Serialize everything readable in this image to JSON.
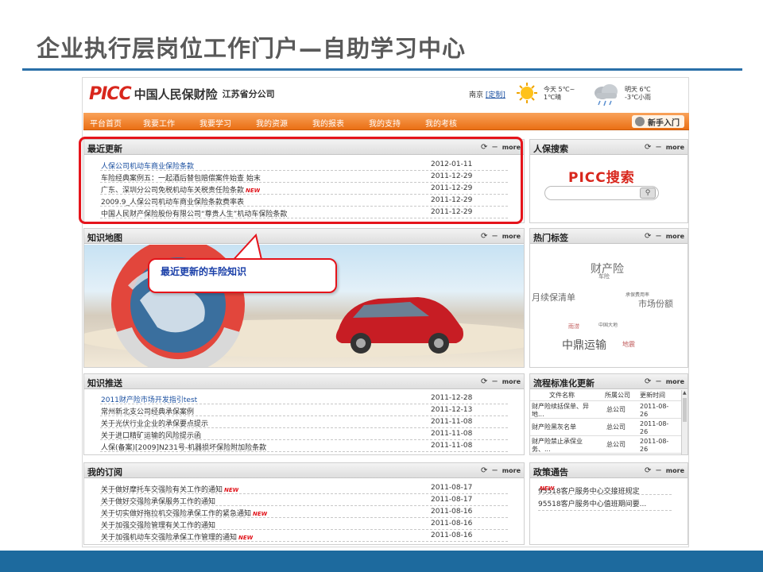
{
  "slide": {
    "title": "企业执行层岗位工作门户—自助学习中心"
  },
  "header": {
    "logo": "PICC",
    "company": "中国人民保财险",
    "branch": "江苏省分公司",
    "city": "南京",
    "city_link": "[定制]",
    "today_line1": "今天 5℃~",
    "today_line2": "1℃晴",
    "tomorrow_line1": "明天 6℃",
    "tomorrow_line2": "-3℃小雨"
  },
  "nav": {
    "items": [
      "平台首页",
      "我要工作",
      "我要学习",
      "我的资源",
      "我的报表",
      "我的支持",
      "我的考核"
    ],
    "newbie": "新手入门"
  },
  "panel_common": {
    "refresh": "⟳",
    "minimize": "−",
    "more": "more"
  },
  "recent": {
    "title": "最近更新",
    "rows": [
      {
        "title": "人保公司机动车商业保险条款",
        "date": "2012-01-11"
      },
      {
        "title": "车险经典案例五：一起酒后替包赔偿案件始查 始末",
        "date": "2011-12-29"
      },
      {
        "title": "广东、深圳分公司免税机动车关税责任险条款",
        "date": "2011-12-29",
        "new": "NEW"
      },
      {
        "title": "2009.9_人保公司机动车商业保险条款费率表",
        "date": "2011-12-29"
      },
      {
        "title": "中国人民财产保险股份有限公司“尊贵人生”机动车保险条款",
        "date": "2011-12-29"
      }
    ]
  },
  "search": {
    "title": "人保搜索",
    "logo": "PICC搜索"
  },
  "knowledge_map": {
    "title": "知识地图",
    "callout": "最近更新的车险知识"
  },
  "hot_tags": {
    "title": "热门标签",
    "tags": [
      "财产险",
      "月续保清单",
      "市场份额",
      "中鼎运输",
      "地震",
      "雨涝",
      "车险",
      "中国大地",
      "承保费用率"
    ]
  },
  "knowledge_push": {
    "title": "知识推送",
    "rows": [
      {
        "title": "2011财产险市场开发指引test",
        "date": "2011-12-28"
      },
      {
        "title": "常州新北支公司经典承保案例",
        "date": "2011-12-13"
      },
      {
        "title": "关于光伏行业企业的承保要点提示",
        "date": "2011-11-08"
      },
      {
        "title": "关于进口精矿运输的风险提示函",
        "date": "2011-11-08"
      },
      {
        "title": "人保(备案)[2009]N231号-机器损坏保险附加险条款",
        "date": "2011-11-08"
      }
    ]
  },
  "process": {
    "title": "流程标准化更新",
    "headers": [
      "文件名称",
      "所属公司",
      "更新时间"
    ],
    "rows": [
      {
        "name": "财产险续括保单、异地...",
        "company": "总公司",
        "date": "2011-08-26"
      },
      {
        "name": "财产险黑灰名单",
        "company": "总公司",
        "date": "2011-08-26"
      },
      {
        "name": "财产险禁止承保业务、...",
        "company": "总公司",
        "date": "2011-08-26"
      }
    ]
  },
  "subscription": {
    "title": "我的订阅",
    "rows": [
      {
        "title": "关于做好摩托车交强险有关工作的通知",
        "date": "2011-08-17",
        "new": "NEW"
      },
      {
        "title": "关于做好交强险承保服务工作的通知",
        "date": "2011-08-17"
      },
      {
        "title": "关于切实做好拖拉机交强险承保工作的紧急通知",
        "date": "2011-08-16",
        "new": "NEW"
      },
      {
        "title": "关于加强交强险管理有关工作的通知",
        "date": "2011-08-16"
      },
      {
        "title": "关于加强机动车交强险承保工作管理的通知",
        "date": "2011-08-16",
        "new": "NEW"
      }
    ]
  },
  "policy": {
    "title": "政策通告",
    "rows": [
      {
        "title": "95518客户服务中心交接班规定",
        "new": "NEW"
      },
      {
        "title": "95518客户服务中心值班期间要..."
      }
    ]
  }
}
